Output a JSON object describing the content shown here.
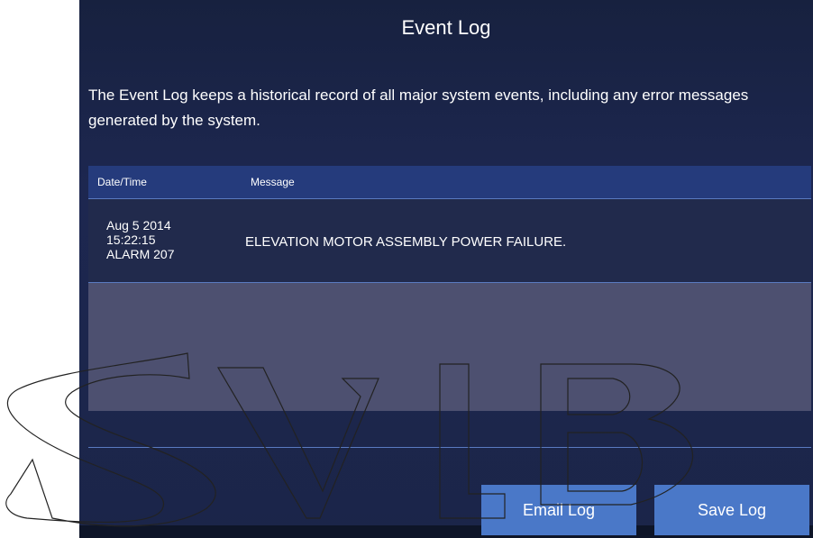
{
  "header": {
    "title": "Event Log"
  },
  "description": "The Event Log keeps a historical record of all major system events, including any error messages generated by the system.",
  "table": {
    "columns": [
      "Date/Time",
      "Message"
    ],
    "rows": [
      {
        "date": "Aug 5 2014",
        "time": "15:22:15",
        "code": "ALARM 207",
        "message": "ELEVATION MOTOR ASSEMBLY POWER FAILURE."
      }
    ]
  },
  "buttons": {
    "email": "Email Log",
    "save": "Save Log"
  },
  "watermark": {
    "text": "SVLB"
  },
  "colors": {
    "background": "#1b2549",
    "header_row": "#253b7c",
    "button": "#4a78c8",
    "empty_row": "#4d5070"
  }
}
